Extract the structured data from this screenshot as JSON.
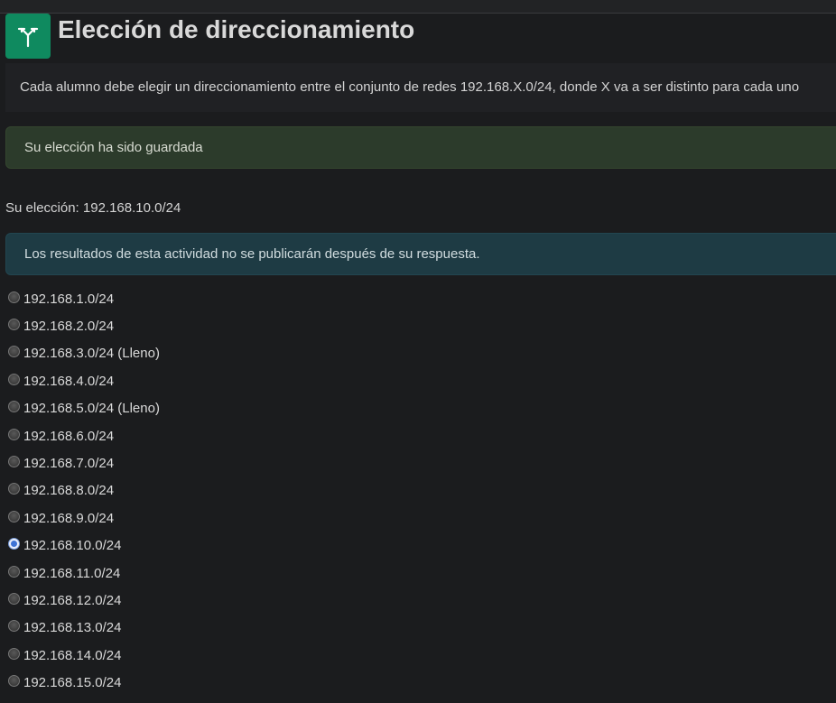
{
  "page": {
    "title": "Elección de direccionamiento",
    "icon": "choice-signpost-icon",
    "accent": "#0f8a5f"
  },
  "intro": {
    "text": "Cada alumno debe elegir un direccionamiento entre el conjunto de redes 192.168.X.0/24, donde X va a ser distinto para cada uno"
  },
  "alerts": {
    "saved": "Su elección ha sido guardada",
    "results_info": "Los resultados de esta actividad no se publicarán después de su respuesta."
  },
  "current_choice": "Su elección: 192.168.10.0/24",
  "options": [
    {
      "label": "192.168.1.0/24",
      "checked": false
    },
    {
      "label": "192.168.2.0/24",
      "checked": false
    },
    {
      "label": "192.168.3.0/24 (Lleno)",
      "checked": false
    },
    {
      "label": "192.168.4.0/24",
      "checked": false
    },
    {
      "label": "192.168.5.0/24 (Lleno)",
      "checked": false
    },
    {
      "label": "192.168.6.0/24",
      "checked": false
    },
    {
      "label": "192.168.7.0/24",
      "checked": false
    },
    {
      "label": "192.168.8.0/24",
      "checked": false
    },
    {
      "label": "192.168.9.0/24",
      "checked": false
    },
    {
      "label": "192.168.10.0/24",
      "checked": true
    },
    {
      "label": "192.168.11.0/24",
      "checked": false
    },
    {
      "label": "192.168.12.0/24",
      "checked": false
    },
    {
      "label": "192.168.13.0/24",
      "checked": false
    },
    {
      "label": "192.168.14.0/24",
      "checked": false
    },
    {
      "label": "192.168.15.0/24",
      "checked": false
    }
  ]
}
